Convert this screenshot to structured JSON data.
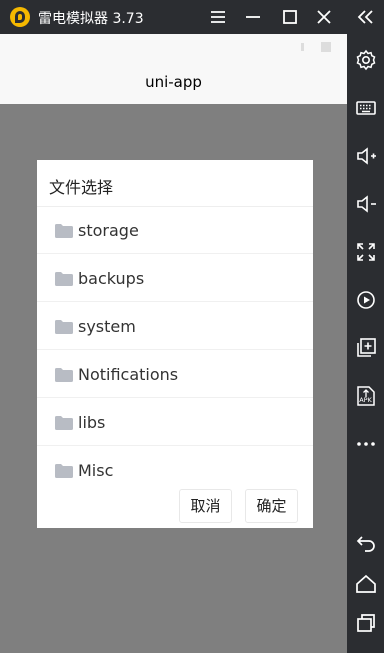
{
  "titlebar": {
    "app_title": "雷电模拟器 3.73",
    "menu_icon": "hamburger-menu-icon",
    "minimize_icon": "minimize-icon",
    "maximize_icon": "maximize-icon",
    "close_icon": "close-icon",
    "collapse_icon": "double-chevron-left-icon"
  },
  "sidebar": {
    "items": [
      {
        "icon": "gear-icon"
      },
      {
        "icon": "keyboard-icon"
      },
      {
        "icon": "volume-up-icon"
      },
      {
        "icon": "volume-down-icon"
      },
      {
        "icon": "fullscreen-icon"
      },
      {
        "icon": "screen-record-icon"
      },
      {
        "icon": "add-window-icon"
      },
      {
        "icon": "apk-install-icon"
      },
      {
        "icon": "more-icon"
      },
      {
        "icon": "back-icon"
      },
      {
        "icon": "home-icon"
      },
      {
        "icon": "recent-apps-icon"
      }
    ]
  },
  "app": {
    "nav_title": "uni-app"
  },
  "dialog": {
    "title": "文件选择",
    "items": [
      {
        "label": "storage",
        "icon": "folder-icon"
      },
      {
        "label": "backups",
        "icon": "folder-icon"
      },
      {
        "label": "system",
        "icon": "folder-icon"
      },
      {
        "label": "Notifications",
        "icon": "folder-icon"
      },
      {
        "label": "libs",
        "icon": "folder-icon"
      },
      {
        "label": "Misc",
        "icon": "folder-icon"
      }
    ],
    "cancel_label": "取消",
    "confirm_label": "确定"
  },
  "colors": {
    "titlebar_bg": "#2b2d31",
    "overlay": "rgba(0,0,0,0.5)",
    "folder": "#b8bcc4",
    "logo": "#f5b800"
  }
}
